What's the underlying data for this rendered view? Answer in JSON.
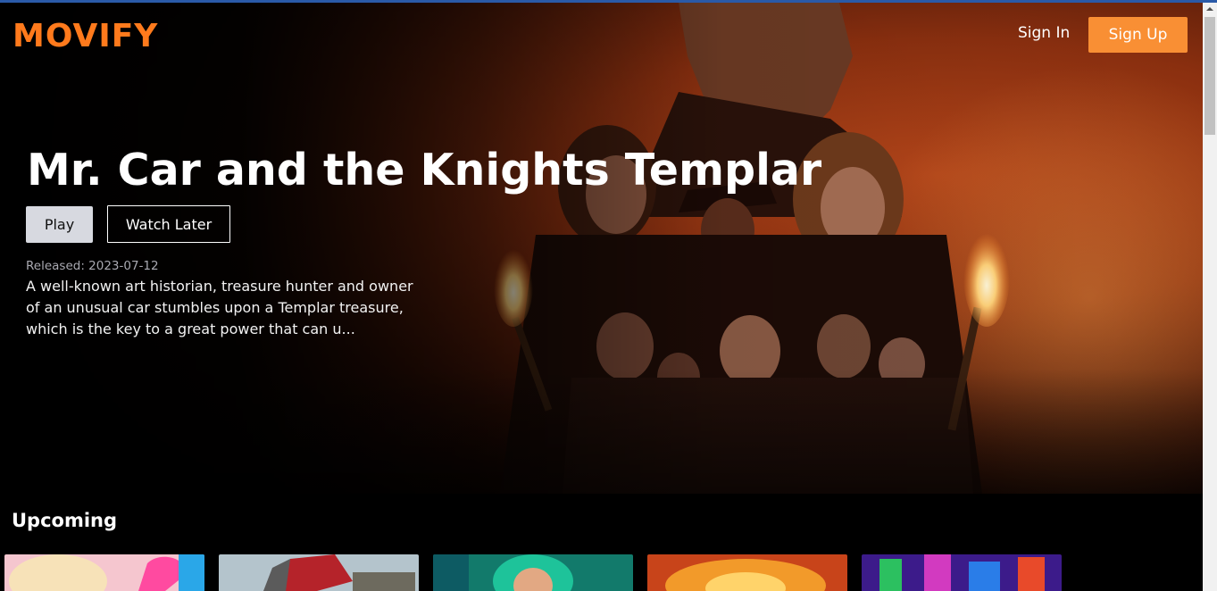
{
  "brand": {
    "logo_text": "MOVIFY",
    "accent": "#ff7a1c"
  },
  "header": {
    "sign_in_label": "Sign In",
    "sign_up_label": "Sign Up"
  },
  "hero": {
    "title": "Mr. Car and the Knights Templar",
    "play_label": "Play",
    "watch_later_label": "Watch Later",
    "released_label": "Released: 2023-07-12",
    "description": "A well-known art historian, treasure hunter and owner of an unusual car stumbles upon a Templar treasure, which is the key to a great power that can u..."
  },
  "upcoming": {
    "heading": "Upcoming",
    "posters": [
      {
        "icon": "poster-image",
        "tone": "#f1a6b8"
      },
      {
        "icon": "poster-image",
        "tone": "#8fa7b8"
      },
      {
        "icon": "poster-image",
        "tone": "#23a38f"
      },
      {
        "icon": "poster-image",
        "tone": "#e5541a"
      },
      {
        "icon": "poster-image",
        "tone": "#5b2ad0"
      }
    ]
  },
  "colors": {
    "signup_bg": "#f98f34",
    "play_bg": "#d7d9e0"
  }
}
